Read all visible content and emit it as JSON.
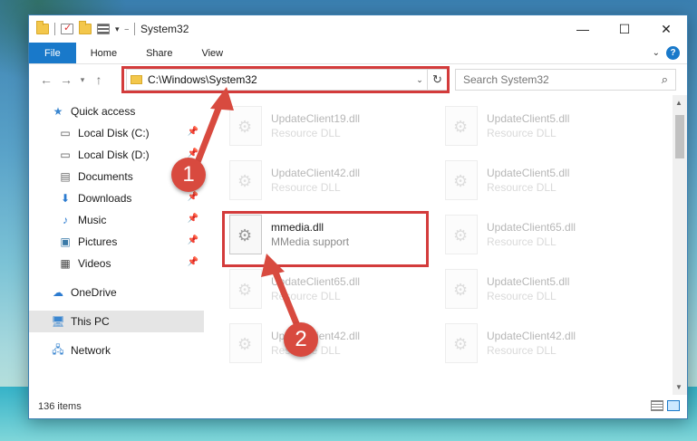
{
  "window": {
    "title": "System32"
  },
  "titlebar_controls": {
    "minimize": "—",
    "maximize": "☐",
    "close": "✕"
  },
  "ribbon": {
    "tabs": [
      "File",
      "Home",
      "Share",
      "View"
    ],
    "help": "?"
  },
  "address": {
    "path": "C:\\Windows\\System32",
    "search_placeholder": "Search System32"
  },
  "nav": {
    "items": [
      {
        "label": "Quick access",
        "icon": "star-icon"
      },
      {
        "label": "Local Disk (C:)",
        "icon": "drive-icon"
      },
      {
        "label": "Local Disk (D:)",
        "icon": "drive-icon"
      },
      {
        "label": "Documents",
        "icon": "documents-icon"
      },
      {
        "label": "Downloads",
        "icon": "download-icon"
      },
      {
        "label": "Music",
        "icon": "music-icon"
      },
      {
        "label": "Pictures",
        "icon": "pictures-icon"
      },
      {
        "label": "Videos",
        "icon": "videos-icon"
      },
      {
        "label": "OneDrive",
        "icon": "cloud-icon"
      },
      {
        "label": "This PC",
        "icon": "computer-icon"
      },
      {
        "label": "Network",
        "icon": "network-icon"
      }
    ]
  },
  "files": [
    {
      "name": "UpdateClient19.dll",
      "desc": "Resource DLL"
    },
    {
      "name": "UpdateClient5.dll",
      "desc": "Resource DLL"
    },
    {
      "name": "UpdateClient42.dll",
      "desc": "Resource DLL"
    },
    {
      "name": "UpdateClient5.dll",
      "desc": "Resource DLL"
    },
    {
      "name": "mmedia.dll",
      "desc": "MMedia support"
    },
    {
      "name": "UpdateClient65.dll",
      "desc": "Resource DLL"
    },
    {
      "name": "UpdateClient65.dll",
      "desc": "Resource DLL"
    },
    {
      "name": "UpdateClient5.dll",
      "desc": "Resource DLL"
    },
    {
      "name": "UpdateClient42.dll",
      "desc": "Resource DLL"
    },
    {
      "name": "UpdateClient42.dll",
      "desc": "Resource DLL"
    }
  ],
  "status": {
    "count": "136 items"
  },
  "annotations": {
    "badge1": "1",
    "badge2": "2",
    "color": "#d84a3f"
  }
}
